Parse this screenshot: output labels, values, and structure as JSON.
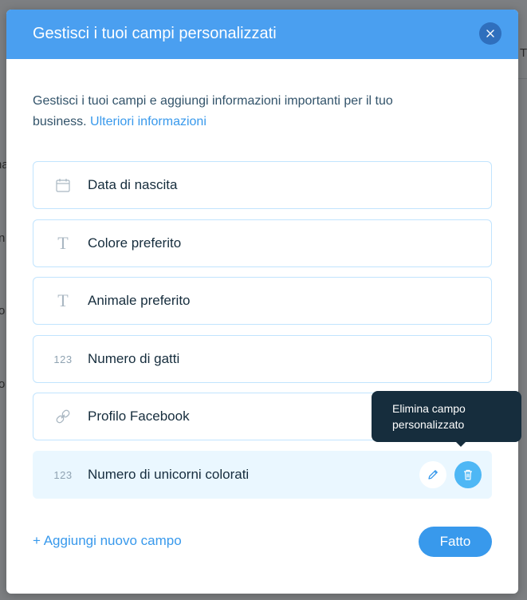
{
  "backdrop": {
    "fragments": [
      "T",
      "na",
      "n",
      "o",
      "o"
    ]
  },
  "modal": {
    "title": "Gestisci i tuoi campi personalizzati",
    "description": "Gestisci i tuoi campi e aggiungi informazioni importanti per il tuo business.",
    "learn_more": "Ulteriori informazioni"
  },
  "fields": [
    {
      "icon": "calendar-icon",
      "label": "Data di nascita"
    },
    {
      "icon": "text-icon",
      "icon_text": "T",
      "label": "Colore preferito"
    },
    {
      "icon": "text-icon",
      "icon_text": "T",
      "label": "Animale preferito"
    },
    {
      "icon": "number-icon",
      "icon_text": "123",
      "label": "Numero di gatti"
    },
    {
      "icon": "link-icon",
      "label": "Profilo Facebook"
    },
    {
      "icon": "number-icon",
      "icon_text": "123",
      "label": "Numero di unicorni colorati"
    }
  ],
  "tooltip": {
    "text": "Elimina campo personalizzato"
  },
  "footer": {
    "add_field": "+ Aggiungi nuovo campo",
    "done": "Fatto"
  },
  "colors": {
    "header": "#4a9ff0",
    "accent": "#3899ec",
    "hover_row": "#eaf7ff",
    "tooltip_bg": "#162d3d"
  }
}
